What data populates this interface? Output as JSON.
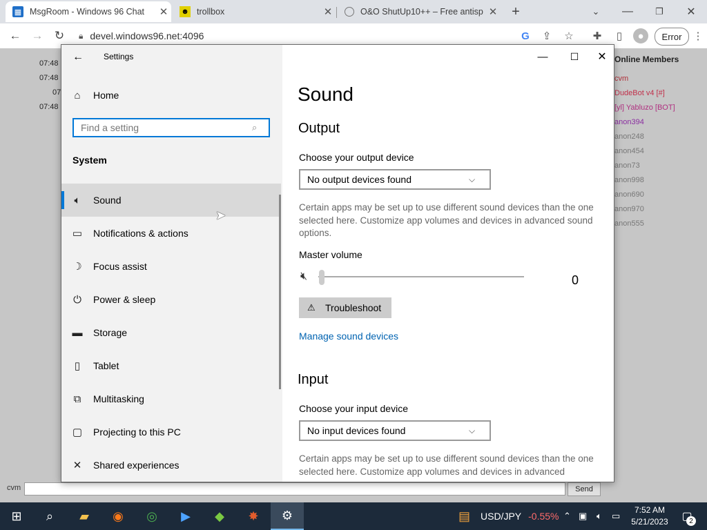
{
  "browser": {
    "tabs": [
      {
        "title": "MsgRoom - Windows 96 Chat",
        "active": true
      },
      {
        "title": "trollbox",
        "active": false
      },
      {
        "title": "O&O ShutUp10++ – Free antisp",
        "active": false
      }
    ],
    "new_tab": "+",
    "url": "devel.windows96.net:4096",
    "error_label": "Error"
  },
  "chat": {
    "times": [
      "07:48",
      "07:48",
      "07",
      "07:48"
    ],
    "members_title": "Online Members",
    "members": [
      {
        "name": "cvm",
        "color": "#b0303a"
      },
      {
        "name": "DudeBot v4 [#]",
        "color": "#c0304a"
      },
      {
        "name": "[yl] Yabluzo [BOT]",
        "color": "#b03080"
      },
      {
        "name": "anon394",
        "color": "#8a2ea0"
      },
      {
        "name": "anon248",
        "color": "#777777"
      },
      {
        "name": "anon454",
        "color": "#777777"
      },
      {
        "name": "anon73",
        "color": "#777777"
      },
      {
        "name": "anon998",
        "color": "#777777"
      },
      {
        "name": "anon690",
        "color": "#777777"
      },
      {
        "name": "anon970",
        "color": "#777777"
      },
      {
        "name": "anon555",
        "color": "#777777"
      }
    ],
    "nickname": "cvm",
    "send_label": "Send"
  },
  "settings": {
    "window_title": "Settings",
    "home": "Home",
    "search_placeholder": "Find a setting",
    "section": "System",
    "nav": [
      {
        "label": "Sound",
        "icon": "speaker-icon",
        "selected": true
      },
      {
        "label": "Notifications & actions",
        "icon": "message-icon",
        "selected": false
      },
      {
        "label": "Focus assist",
        "icon": "moon-icon",
        "selected": false
      },
      {
        "label": "Power & sleep",
        "icon": "power-icon",
        "selected": false
      },
      {
        "label": "Storage",
        "icon": "storage-icon",
        "selected": false
      },
      {
        "label": "Tablet",
        "icon": "tablet-icon",
        "selected": false
      },
      {
        "label": "Multitasking",
        "icon": "multitasking-icon",
        "selected": false
      },
      {
        "label": "Projecting to this PC",
        "icon": "projector-icon",
        "selected": false
      },
      {
        "label": "Shared experiences",
        "icon": "share-icon",
        "selected": false
      }
    ],
    "page_title": "Sound",
    "output": {
      "heading": "Output",
      "choose_label": "Choose your output device",
      "device": "No output devices found",
      "description": "Certain apps may be set up to use different sound devices than the one selected here. Customize app volumes and devices in advanced sound options.",
      "master_volume_label": "Master volume",
      "volume_value": "0",
      "troubleshoot_label": "Troubleshoot",
      "manage_link": "Manage sound devices"
    },
    "input": {
      "heading": "Input",
      "choose_label": "Choose your input device",
      "device": "No input devices found",
      "description": "Certain apps may be set up to use different sound devices than the one selected here. Customize app volumes and devices in advanced"
    }
  },
  "taskbar": {
    "ticker_symbol": "USD/JPY",
    "ticker_change": "-0.55%",
    "time": "7:52 AM",
    "date": "5/21/2023",
    "notifications": "2"
  }
}
